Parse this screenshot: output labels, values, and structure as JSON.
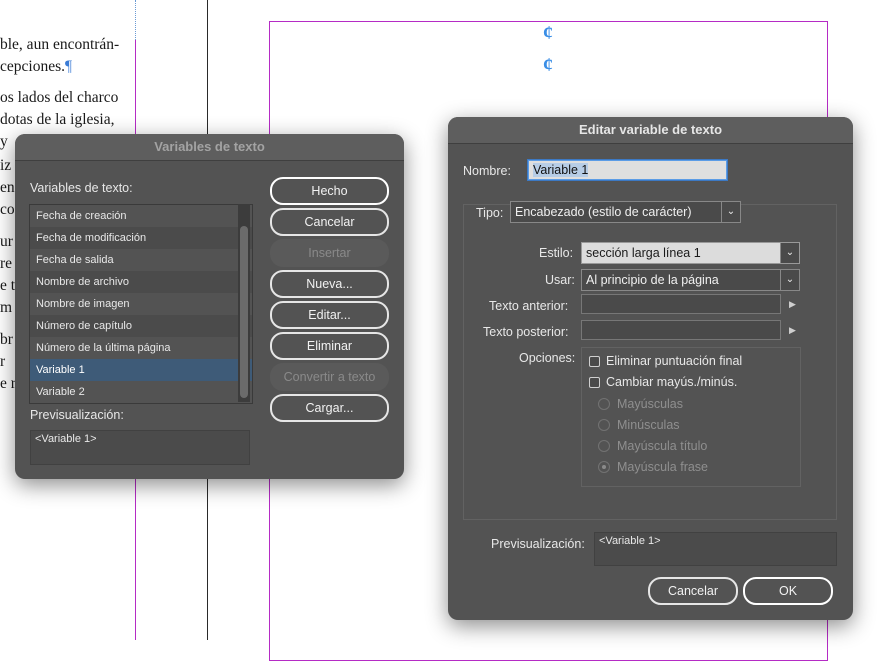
{
  "document": {
    "lines": [
      {
        "text": "ble, aun encontrán-",
        "pilcrow": ""
      },
      {
        "text": "cepciones.",
        "pilcrow": "¶"
      },
      {
        "text": "os lados del charco",
        "pilcrow": ""
      },
      {
        "text": "dotas de la iglesia,",
        "pilcrow": ""
      },
      {
        "text": "y",
        "pilcrow": ""
      },
      {
        "text": "iz",
        "pilcrow": ""
      },
      {
        "text": "en",
        "pilcrow": ""
      },
      {
        "text": "co",
        "pilcrow": ""
      },
      {
        "text": "ur",
        "pilcrow": ""
      },
      {
        "text": "re",
        "pilcrow": ""
      },
      {
        "text": "e t",
        "pilcrow": ""
      },
      {
        "text": "m",
        "pilcrow": ""
      },
      {
        "text": "br",
        "pilcrow": ""
      },
      {
        "text": "r",
        "pilcrow": ""
      },
      {
        "text": "e r",
        "pilcrow": ""
      }
    ],
    "glyph": "¢"
  },
  "variables_dialog": {
    "title": "Variables de texto",
    "list_label": "Variables de texto:",
    "items": [
      "Fecha de creación",
      "Fecha de modificación",
      "Fecha de salida",
      "Nombre de archivo",
      "Nombre de imagen",
      "Número de capítulo",
      "Número de la última página",
      "Variable 1",
      "Variable 2"
    ],
    "selected": "Variable 1",
    "preview_label": "Previsualización:",
    "preview_value": "<Variable 1>",
    "buttons": {
      "done": "Hecho",
      "cancel": "Cancelar",
      "insert": "Insertar",
      "new": "Nueva...",
      "edit": "Editar...",
      "delete": "Eliminar",
      "convert": "Convertir a texto",
      "load": "Cargar..."
    }
  },
  "edit_dialog": {
    "title": "Editar variable de texto",
    "name_label": "Nombre:",
    "name_value": "Variable 1",
    "type_label": "Tipo:",
    "type_value": "Encabezado (estilo de carácter)",
    "style_label": "Estilo:",
    "style_value": "sección larga línea 1",
    "use_label": "Usar:",
    "use_value": "Al principio de la página",
    "text_before_label": "Texto anterior:",
    "text_before_value": "",
    "text_after_label": "Texto posterior:",
    "text_after_value": "",
    "options_label": "Opciones:",
    "options": {
      "remove_punctuation": "Eliminar puntuación final",
      "change_case": "Cambiar mayús./minús.",
      "uppercase": "Mayúsculas",
      "lowercase": "Minúsculas",
      "title_case": "Mayúscula título",
      "sentence_case": "Mayúscula frase"
    },
    "preview_label": "Previsualización:",
    "preview_value": "<Variable 1>",
    "buttons": {
      "cancel": "Cancelar",
      "ok": "OK"
    }
  },
  "colors": {
    "frame": "#b52bc5",
    "selection": "#3e5b78",
    "dialog_bg": "#535353"
  }
}
